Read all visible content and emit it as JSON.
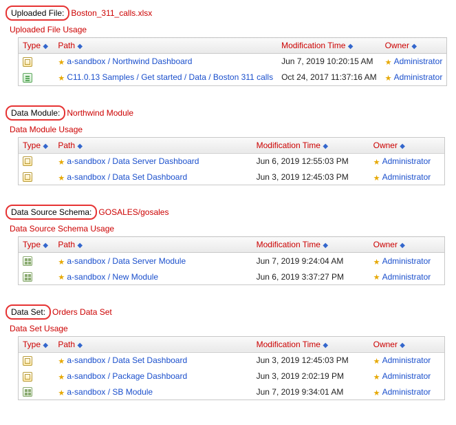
{
  "columns": {
    "type": "Type",
    "path": "Path",
    "modified": "Modification Time",
    "owner": "Owner"
  },
  "sections": [
    {
      "label": "Uploaded File:",
      "value": "Boston_311_calls.xlsx",
      "usage_title": "Uploaded File Usage",
      "rows": [
        {
          "icon": "dashboard",
          "path": "a-sandbox / Northwind Dashboard",
          "modified": "Jun 7, 2019 10:20:15 AM",
          "owner": "Administrator"
        },
        {
          "icon": "report",
          "path": "C11.0.13 Samples / Get started / Data / Boston 311 calls",
          "modified": "Oct 24, 2017 11:37:16 AM",
          "owner": "Administrator"
        }
      ]
    },
    {
      "label": "Data Module:",
      "value": "Northwind Module",
      "usage_title": "Data Module Usage",
      "rows": [
        {
          "icon": "dashboard",
          "path": "a-sandbox / Data Server Dashboard",
          "modified": "Jun 6, 2019 12:55:03 PM",
          "owner": "Administrator"
        },
        {
          "icon": "dashboard",
          "path": "a-sandbox / Data Set Dashboard",
          "modified": "Jun 3, 2019 12:45:03 PM",
          "owner": "Administrator"
        }
      ]
    },
    {
      "label": "Data Source Schema:",
      "value": "GOSALES/gosales",
      "usage_title": "Data Source Schema Usage",
      "rows": [
        {
          "icon": "module",
          "path": "a-sandbox / Data Server Module",
          "modified": "Jun 7, 2019 9:24:04 AM",
          "owner": "Administrator"
        },
        {
          "icon": "module",
          "path": "a-sandbox / New Module",
          "modified": "Jun 6, 2019 3:37:27 PM",
          "owner": "Administrator"
        }
      ]
    },
    {
      "label": "Data Set:",
      "value": "Orders Data Set",
      "usage_title": "Data Set Usage",
      "rows": [
        {
          "icon": "dashboard",
          "path": "a-sandbox / Data Set Dashboard",
          "modified": "Jun 3, 2019 12:45:03 PM",
          "owner": "Administrator"
        },
        {
          "icon": "dashboard",
          "path": "a-sandbox / Package Dashboard",
          "modified": "Jun 3, 2019 2:02:19 PM",
          "owner": "Administrator"
        },
        {
          "icon": "module",
          "path": "a-sandbox / SB Module",
          "modified": "Jun 7, 2019 9:34:01 AM",
          "owner": "Administrator"
        }
      ]
    }
  ]
}
